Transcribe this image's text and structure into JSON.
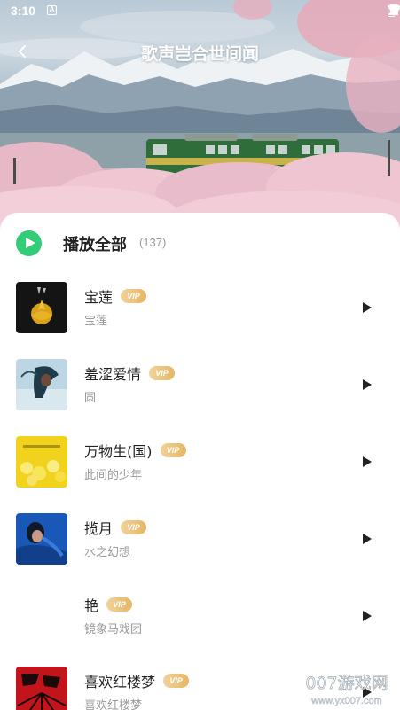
{
  "status_bar": {
    "time": "3:10",
    "notification_glyph": "A"
  },
  "header": {
    "title": "歌声岂合世间闻",
    "back_icon": "chevron-left-icon"
  },
  "play_all": {
    "label": "播放全部",
    "count": "(137)",
    "icon_color": "#33cc77"
  },
  "vip_badge": "VIP",
  "songs": [
    {
      "title": "宝莲",
      "artist": "宝莲",
      "cover": "dark-gold-lotus"
    },
    {
      "title": "羞涩爱情",
      "artist": "圆",
      "cover": "blue-portrait"
    },
    {
      "title": "万物生(国)",
      "artist": "此间的少年",
      "cover": "yellow-flowers"
    },
    {
      "title": "揽月",
      "artist": "水之幻想",
      "cover": "blue-figure"
    },
    {
      "title": "艳",
      "artist": "镜象马戏团",
      "cover": "none"
    },
    {
      "title": "喜欢红楼梦",
      "artist": "喜欢红楼梦",
      "cover": "red-black-calligraphy"
    }
  ],
  "watermark": {
    "text": "007游戏网",
    "url": "www.yx007.com"
  }
}
